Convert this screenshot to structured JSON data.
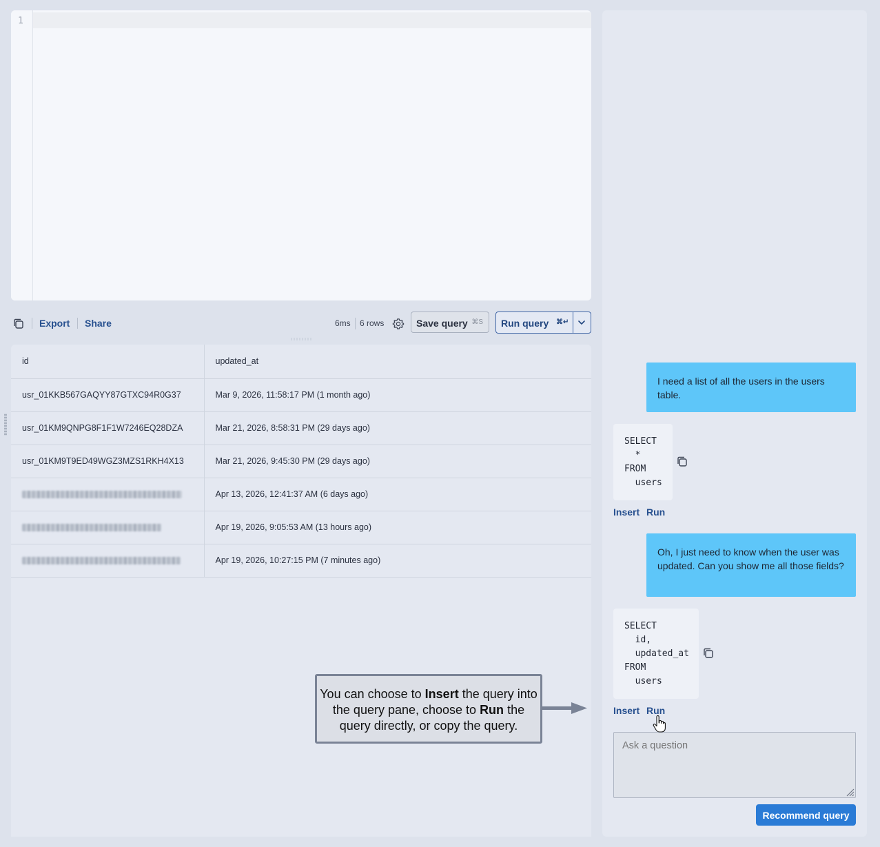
{
  "editor": {
    "line_number": "1"
  },
  "toolbar": {
    "copy_icon": "copy-icon",
    "export_label": "Export",
    "share_label": "Share",
    "time": "6ms",
    "rows": "6 rows",
    "settings_icon": "gear-icon",
    "save_label": "Save query",
    "save_shortcut": "⌘S",
    "run_label": "Run query",
    "run_shortcut": "⌘↵",
    "run_menu_icon": "chevron-down-icon"
  },
  "table": {
    "columns": [
      "id",
      "updated_at"
    ],
    "rows": [
      {
        "id": "usr_01KKB567GAQYY87GTXC94R0G37",
        "updated_at": "Mar 9, 2026, 11:58:17 PM (1 month ago)",
        "redacted": false
      },
      {
        "id": "usr_01KM9QNPG8F1F1W7246EQ28DZA",
        "updated_at": "Mar 21, 2026, 8:58:31 PM (29 days ago)",
        "redacted": false
      },
      {
        "id": "usr_01KM9T9ED49WGZ3MZS1RKH4X13",
        "updated_at": "Mar 21, 2026, 9:45:30 PM (29 days ago)",
        "redacted": false
      },
      {
        "id": "",
        "updated_at": "Apr 13, 2026, 12:41:37 AM (6 days ago)",
        "redacted": true
      },
      {
        "id": "",
        "updated_at": "Apr 19, 2026, 9:05:53 AM (13 hours ago)",
        "redacted": true
      },
      {
        "id": "",
        "updated_at": "Apr 19, 2026, 10:27:15 PM (7 minutes ago)",
        "redacted": true
      }
    ]
  },
  "callout": {
    "part1": "You can choose to ",
    "bold1": "Insert",
    "part2": " the query into the query pane, choose to ",
    "bold2": "Run",
    "part3": " the query directly, or copy the query."
  },
  "chat": {
    "messages": [
      {
        "role": "user",
        "text": "I need a list of all the users in the users table."
      },
      {
        "role": "assistant",
        "code": "SELECT\n  *\nFROM\n  users",
        "insert_label": "Insert",
        "run_label": "Run"
      },
      {
        "role": "user",
        "text": "Oh, I just need to know when the user was updated. Can you show me all those fields?"
      },
      {
        "role": "assistant",
        "code": "SELECT\n  id,\n  updated_at\nFROM\n  users",
        "insert_label": "Insert",
        "run_label": "Run"
      }
    ],
    "input_placeholder": "Ask a question",
    "recommend_label": "Recommend query"
  }
}
